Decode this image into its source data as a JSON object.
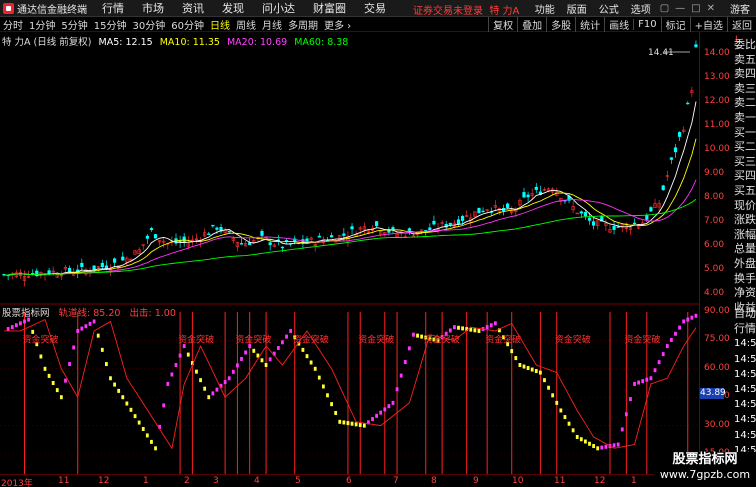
{
  "app": {
    "name": "通达信金融终端",
    "menu": [
      "行情",
      "市场",
      "资讯",
      "发现",
      "问小达",
      "财富圈",
      "交易"
    ],
    "notice": "证券交易未登录",
    "stock_title": "特 力A",
    "right_menu": [
      "功能",
      "版面",
      "公式",
      "选项"
    ],
    "user": "游客",
    "window_buttons": [
      "▢",
      "—",
      "□",
      "✕"
    ]
  },
  "periods": [
    "分时",
    "1分钟",
    "5分钟",
    "15分钟",
    "30分钟",
    "60分钟",
    "日线",
    "周线",
    "月线",
    "多周期",
    "更多 ›"
  ],
  "active_period": "日线",
  "tools": [
    "复权",
    "叠加",
    "多股",
    "统计",
    "画线",
    "F10",
    "标记",
    "+自选",
    "返回"
  ],
  "main_chart": {
    "name": "特 力A (日线 前复权)",
    "ma5": "MA5: 12.15",
    "ma10": "MA10: 11.35",
    "ma20": "MA20: 10.69",
    "ma60": "MA60: 8.38",
    "high_label": "14.41",
    "yticks": [
      "14.00",
      "13.00",
      "12.00",
      "11.00",
      "10.00",
      "9.00",
      "8.00",
      "7.00",
      "6.00",
      "5.00",
      "4.00"
    ]
  },
  "indicator": {
    "name": "股票指标网",
    "line1": "轨道线: 85.20",
    "line2": "出击: 1.00",
    "label": "资金突破",
    "badge": "43.89",
    "yticks": [
      "90.00",
      "75.00",
      "60.00",
      "45.00",
      "30.00",
      "15.00"
    ]
  },
  "xaxis": [
    "2013年",
    "11",
    "12",
    "1",
    "2",
    "3",
    "4",
    "5",
    "6",
    "7",
    "8",
    "9",
    "10",
    "11",
    "12",
    "1",
    "2"
  ],
  "side_panel": [
    "委比",
    "卖五",
    "卖四",
    "卖三",
    "卖二",
    "卖一",
    "买一",
    "买二",
    "买三",
    "买四",
    "买五",
    "现价",
    "涨跌",
    "涨幅",
    "总量",
    "外盘",
    "换手",
    "净资",
    "收益"
  ],
  "side_panel2": [
    "自动",
    "行情"
  ],
  "side_times": [
    "14:5",
    "14:5",
    "14:5",
    "14:5",
    "14:5",
    "14:5",
    "14:5",
    "14:5",
    "14:5",
    "14:5"
  ],
  "side_badge": "L",
  "watermark": {
    "line1": "股票指标网",
    "line2": "www.7gpzb.com"
  },
  "colors": {
    "ma5": "#ffffff",
    "ma10": "#ffff00",
    "ma20": "#ff00ff",
    "ma60": "#00ff00",
    "up": "#ff3030",
    "down": "#00ffff",
    "axis": "#ff4040"
  }
}
